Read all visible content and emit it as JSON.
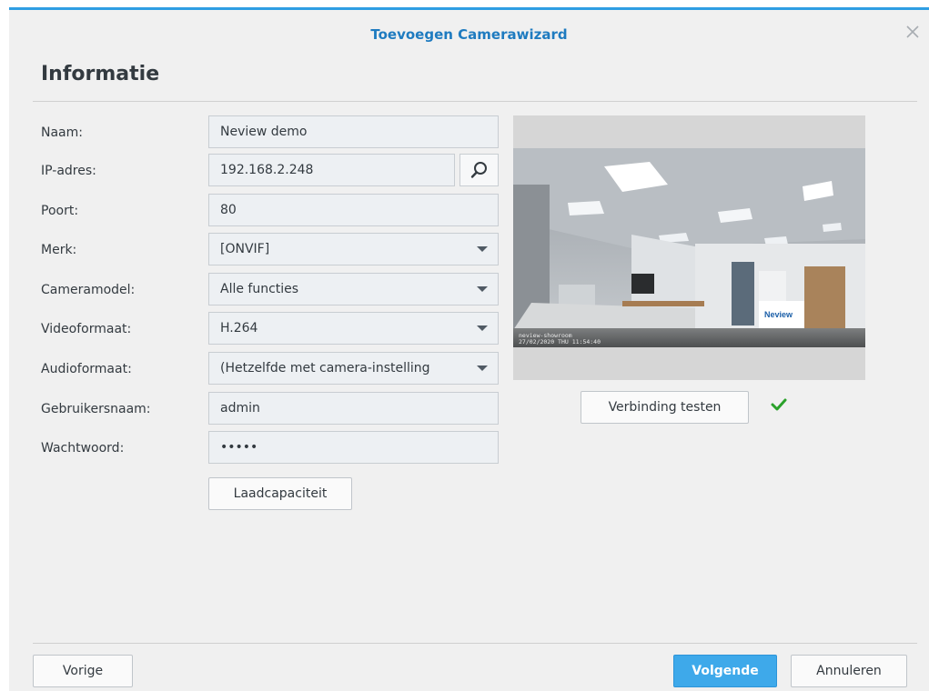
{
  "dialog": {
    "title": "Toevoegen Camerawizard",
    "section_heading": "Informatie"
  },
  "form": {
    "name": {
      "label": "Naam:",
      "value": "Neview demo"
    },
    "ip": {
      "label": "IP-adres:",
      "value": "192.168.2.248"
    },
    "port": {
      "label": "Poort:",
      "value": "80"
    },
    "brand": {
      "label": "Merk:",
      "value": "[ONVIF]"
    },
    "model": {
      "label": "Cameramodel:",
      "value": "Alle functies"
    },
    "video": {
      "label": "Videoformaat:",
      "value": "H.264"
    },
    "audio": {
      "label": "Audioformaat:",
      "value": "(Hetzelfde met camera-instelling"
    },
    "username": {
      "label": "Gebruikersnaam:",
      "value": "admin"
    },
    "password": {
      "label": "Wachtwoord:",
      "value": "•••••"
    },
    "load_button": "Laadcapaciteit"
  },
  "preview": {
    "test_button": "Verbinding testen",
    "test_status": "success",
    "overlay_line1": "neview-showroom",
    "overlay_line2": "27/02/2020 THU 11:54:40",
    "sign_text": "Neview"
  },
  "footer": {
    "back_button": "Vorige",
    "next_button": "Volgende",
    "cancel_button": "Annuleren"
  },
  "colors": {
    "accent": "#2f9ee3",
    "title": "#1e7bc0",
    "primary_button": "#3ea9ea",
    "success": "#2aa12a"
  },
  "icons": {
    "close": "close-icon",
    "search": "search-icon",
    "dropdown": "chevron-down-icon",
    "status": "checkmark-icon"
  }
}
